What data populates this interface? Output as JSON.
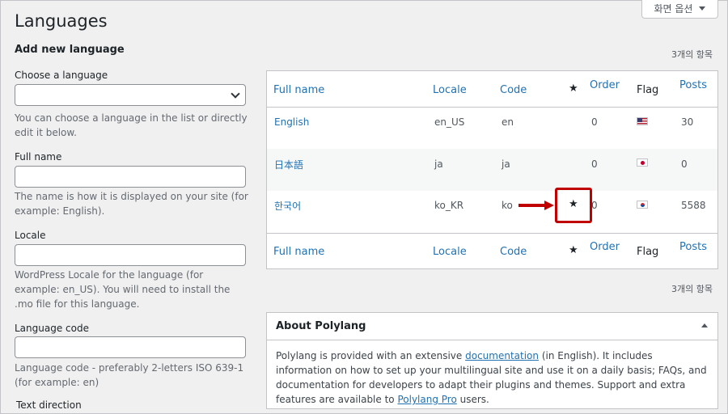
{
  "page": {
    "title": "Languages"
  },
  "screen_options": {
    "label": "화면 옵션"
  },
  "form": {
    "heading": "Add new language",
    "choose_label": "Choose a language",
    "choose_help": "You can choose a language in the list or directly edit it below.",
    "fullname_label": "Full name",
    "fullname_help": "The name is how it is displayed on your site (for example: English).",
    "locale_label": "Locale",
    "locale_help": "WordPress Locale for the language (for example: en_US). You will need to install the .mo file for this language.",
    "code_label": "Language code",
    "code_help": "Language code - preferably 2-letters ISO 639-1 (for example: en)",
    "direction_label": "Text direction"
  },
  "table": {
    "count": "3개의 항목",
    "headers": {
      "full_name": "Full name",
      "locale": "Locale",
      "code": "Code",
      "order": "Order",
      "flag": "Flag",
      "posts": "Posts"
    },
    "rows": [
      {
        "name": "English",
        "locale": "en_US",
        "code": "en",
        "order": "0",
        "flag": "us-flag-icon",
        "posts": "30"
      },
      {
        "name": "日本語",
        "locale": "ja",
        "code": "ja",
        "order": "0",
        "flag": "jp-flag-icon",
        "posts": "0"
      },
      {
        "name": "한국어",
        "locale": "ko_KR",
        "code": "ko",
        "order": "0",
        "flag": "kr-flag-icon",
        "posts": "5588",
        "default": true
      }
    ]
  },
  "about": {
    "title": "About Polylang",
    "text_1": "Polylang is provided with an extensive ",
    "link_doc": "documentation",
    "text_2": " (in English). It includes information on how to set up your multilingual site and use it on a daily basis; FAQs, and documentation for developers to adapt their plugins and themes. Support and extra features are available to ",
    "link_pro": "Polylang Pro",
    "text_3": " users."
  },
  "colors": {
    "link": "#2271b1",
    "highlight": "#c00000"
  }
}
